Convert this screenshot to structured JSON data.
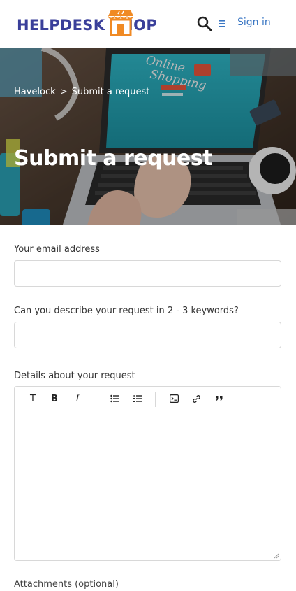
{
  "header": {
    "logo_text": "HELPDESK SHOP",
    "sign_in": "Sign in",
    "brand_color": "#3a3f9a",
    "accent_color": "#f08a24",
    "link_color": "#3b77c4"
  },
  "hero": {
    "breadcrumb": [
      "Havelock",
      ">",
      "Submit a request"
    ],
    "title": "Submit a request",
    "laptop_screen_text": [
      "Online",
      "Shopping"
    ]
  },
  "form": {
    "email_label": "Your email address",
    "email_value": "",
    "subject_label": "Can you describe your request in 2 - 3 keywords?",
    "subject_value": "",
    "details_label": "Details about your request",
    "toolbar": {
      "text": "T",
      "bold": "B",
      "italic": "I",
      "icons": [
        "bulleted-list-icon",
        "numbered-list-icon",
        "code-block-icon",
        "link-icon",
        "quote-icon"
      ]
    },
    "attachments_label": "Attachments (optional)"
  }
}
